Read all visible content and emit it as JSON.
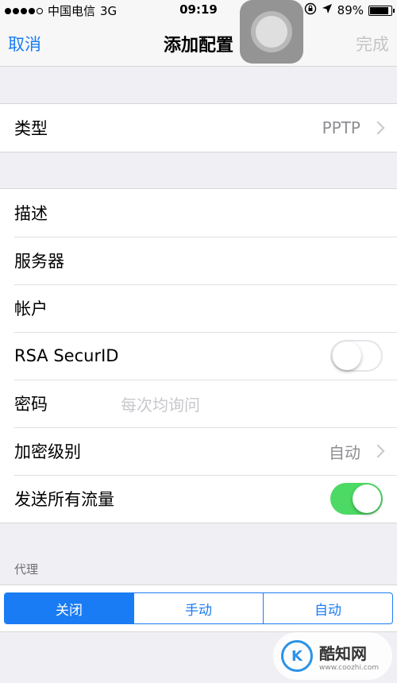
{
  "status_bar": {
    "carrier": "中国电信",
    "network": "3G",
    "time": "09:19",
    "battery_percent": "89%",
    "battery_level": 0.89
  },
  "nav": {
    "cancel_label": "取消",
    "title": "添加配置",
    "done_label": "完成"
  },
  "type_row": {
    "label": "类型",
    "value": "PPTP"
  },
  "fields": {
    "description_label": "描述",
    "server_label": "服务器",
    "account_label": "帐户",
    "rsa_label": "RSA SecurID",
    "rsa_on": false,
    "password_label": "密码",
    "password_placeholder": "每次均询问",
    "encryption_label": "加密级别",
    "encryption_value": "自动",
    "send_all_label": "发送所有流量",
    "send_all_on": true
  },
  "proxy": {
    "header": "代理",
    "options": [
      "关闭",
      "手动",
      "自动"
    ],
    "selected_index": 0
  },
  "watermark": {
    "logo_text": "K",
    "title": "酷知网",
    "url": "www.coozhi.com"
  },
  "colors": {
    "accent": "#1a7cf4",
    "toggle_on": "#4cd964",
    "background": "#efeff4"
  },
  "icons": {
    "location": "location-arrow-icon",
    "lock": "rotation-lock-icon",
    "chevron": "chevron-right-icon"
  }
}
